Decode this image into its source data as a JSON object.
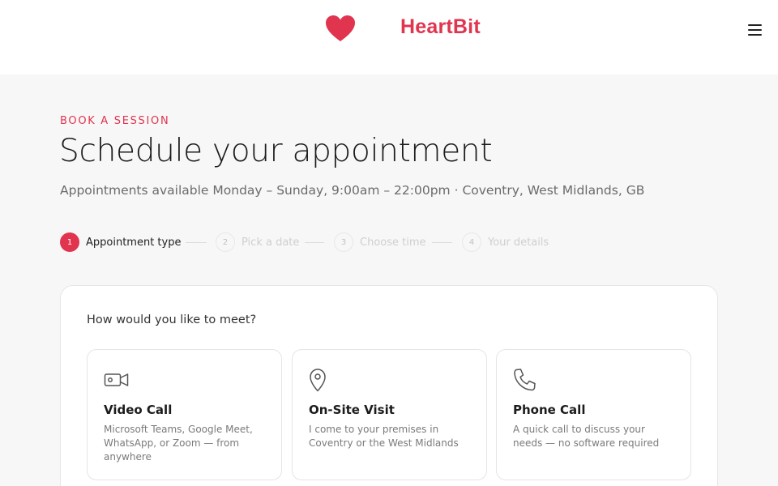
{
  "header": {
    "brand": "HeartBit",
    "logo_icon": "heart-icon",
    "menu_icon": "hamburger-menu-icon",
    "accent_color": "#e0344f"
  },
  "hero": {
    "eyebrow": "BOOK A SESSION",
    "title": "Schedule your appointment",
    "subtitle": "Appointments available Monday – Sunday, 9:00am – 22:00pm · Coventry, West Midlands, GB"
  },
  "steps": [
    {
      "number": "1",
      "label": "Appointment type",
      "state": "active"
    },
    {
      "number": "2",
      "label": "Pick a date",
      "state": "inactive"
    },
    {
      "number": "3",
      "label": "Choose time",
      "state": "inactive"
    },
    {
      "number": "4",
      "label": "Your details",
      "state": "inactive"
    }
  ],
  "booking": {
    "question": "How would you like to meet?",
    "options": [
      {
        "icon": "video-camera-icon",
        "title": "Video Call",
        "description": "Microsoft Teams, Google Meet, WhatsApp, or Zoom — from anywhere"
      },
      {
        "icon": "map-pin-icon",
        "title": "On-Site Visit",
        "description": "I come to your premises in Coventry or the West Midlands"
      },
      {
        "icon": "phone-icon",
        "title": "Phone Call",
        "description": "A quick call to discuss your needs — no software required"
      }
    ]
  }
}
